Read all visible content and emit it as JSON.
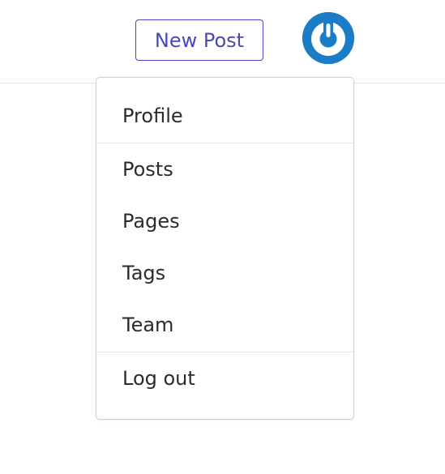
{
  "header": {
    "new_post_label": "New Post"
  },
  "avatar": {
    "icon": "power-icon",
    "color": "#1a7dc6"
  },
  "menu": {
    "items": [
      {
        "label": "Profile"
      },
      {
        "label": "Posts"
      },
      {
        "label": "Pages"
      },
      {
        "label": "Tags"
      },
      {
        "label": "Team"
      },
      {
        "label": "Log out"
      }
    ]
  },
  "colors": {
    "accent": "#4a48b8",
    "text": "#2b2b2b",
    "divider": "#e6e6e6",
    "menu_border": "#cfcfcf"
  }
}
